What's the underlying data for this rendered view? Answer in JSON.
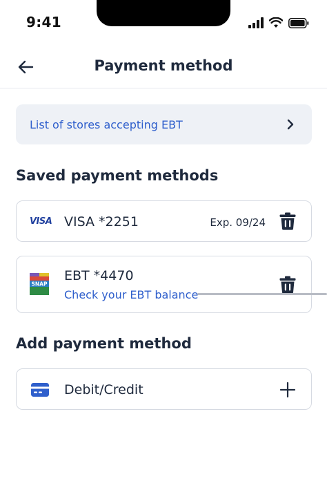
{
  "status_bar": {
    "time": "9:41",
    "icons": [
      "signal-icon",
      "wifi-icon",
      "battery-icon"
    ]
  },
  "nav": {
    "title": "Payment method",
    "back_icon": "arrow-left-icon"
  },
  "ebt_stores_link": {
    "label": "List of stores accepting EBT",
    "icon": "chevron-right-icon"
  },
  "saved_section": {
    "title": "Saved payment methods",
    "cards": [
      {
        "logo": "VISA",
        "name": "VISA *2251",
        "expiry": "Exp. 09/24",
        "delete_icon": "trash-icon"
      },
      {
        "logo": "SNAP",
        "name": "EBT *4470",
        "balance_link": "Check your EBT balance",
        "delete_icon": "trash-icon"
      }
    ]
  },
  "add_section": {
    "title": "Add payment method",
    "options": [
      {
        "label": "Debit/Credit",
        "icon": "credit-card-icon",
        "action_icon": "plus-icon"
      }
    ]
  },
  "colors": {
    "primary_text": "#1f2a3d",
    "link_blue": "#2f5fcc",
    "banner_bg": "#eef1f6",
    "border": "#d6dae2",
    "visa_blue": "#1f3f9e"
  }
}
